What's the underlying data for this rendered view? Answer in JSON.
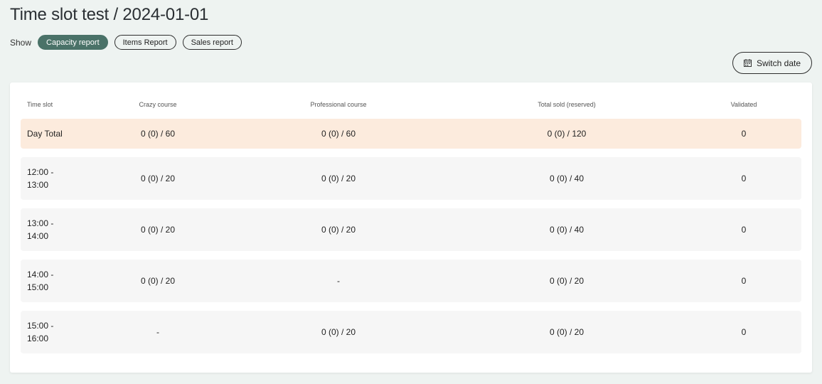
{
  "page": {
    "title": "Time slot test / 2024-01-01"
  },
  "show": {
    "label": "Show",
    "tabs": [
      {
        "label": "Capacity report",
        "active": true
      },
      {
        "label": "Items Report",
        "active": false
      },
      {
        "label": "Sales report",
        "active": false
      }
    ]
  },
  "switch_date": {
    "label": "Switch date",
    "icon": "calendar-icon"
  },
  "table": {
    "columns": [
      "Time slot",
      "Crazy course",
      "Professional course",
      "Total sold (reserved)",
      "Validated"
    ],
    "total_row": {
      "slot": "Day Total",
      "crazy": "0 (0) / 60",
      "professional": "0 (0) / 60",
      "total": "0 (0) / 120",
      "validated": "0"
    },
    "rows": [
      {
        "slot_start": "12:00 -",
        "slot_end": "13:00",
        "crazy": "0 (0) / 20",
        "professional": "0 (0) / 20",
        "total": "0 (0) / 40",
        "validated": "0"
      },
      {
        "slot_start": "13:00 -",
        "slot_end": "14:00",
        "crazy": "0 (0) / 20",
        "professional": "0 (0) / 20",
        "total": "0 (0) / 40",
        "validated": "0"
      },
      {
        "slot_start": "14:00 -",
        "slot_end": "15:00",
        "crazy": "0 (0) / 20",
        "professional": "-",
        "total": "0 (0) / 20",
        "validated": "0"
      },
      {
        "slot_start": "15:00 -",
        "slot_end": "16:00",
        "crazy": "-",
        "professional": "0 (0) / 20",
        "total": "0 (0) / 20",
        "validated": "0"
      }
    ]
  },
  "colors": {
    "background": "#eef3f1",
    "active_pill": "#4a7268",
    "total_row": "#fcebdd",
    "row": "#f6f6f6"
  }
}
